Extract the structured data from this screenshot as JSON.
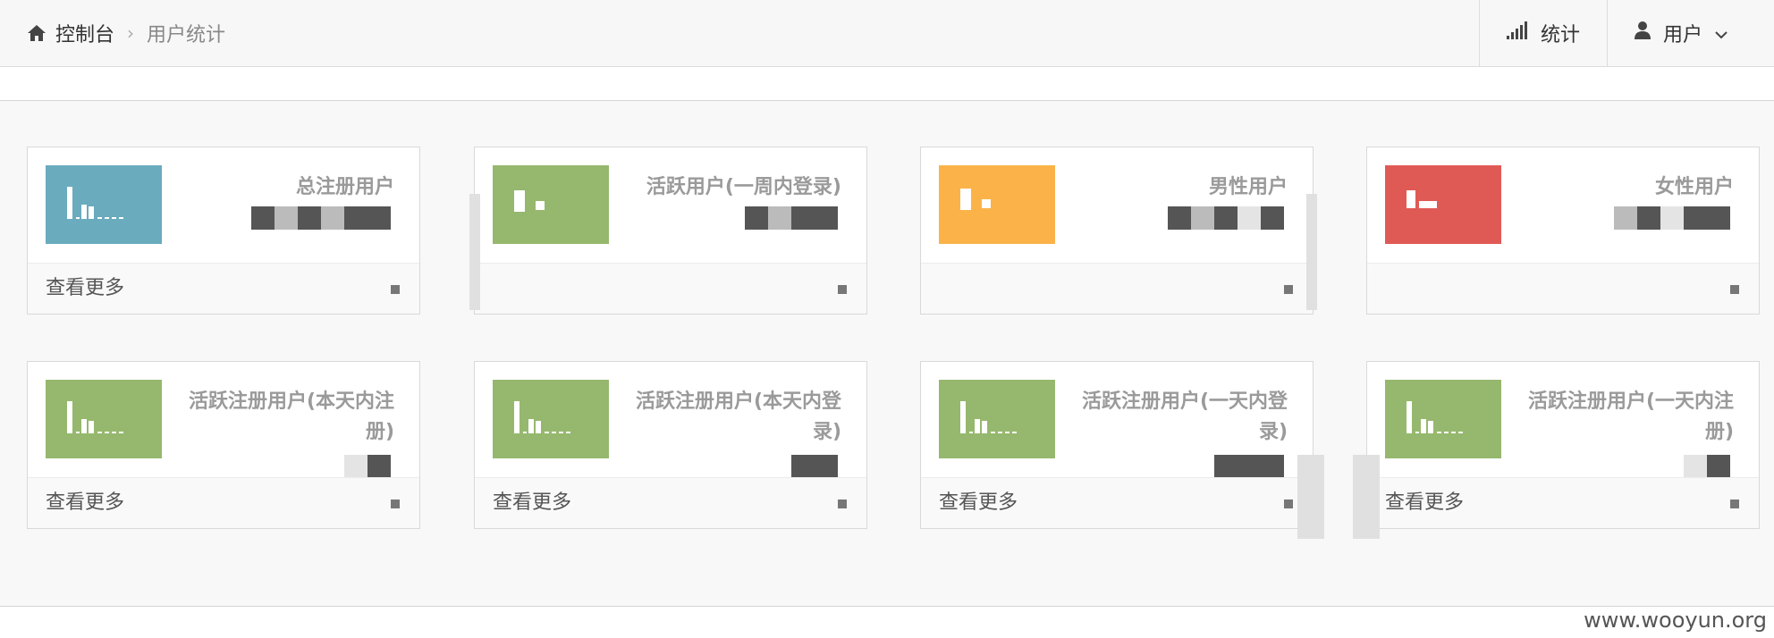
{
  "breadcrumb": {
    "home": "控制台",
    "current": "用户统计"
  },
  "nav": {
    "stats_label": "统计",
    "user_label": "用户"
  },
  "colors": {
    "blue": "#6aabbd",
    "green": "#96b86e",
    "orange": "#fbb349",
    "red": "#e05a55"
  },
  "cards": [
    {
      "title": "总注册用户",
      "footer": "查看更多"
    },
    {
      "title": "活跃用户(一周内登录)",
      "footer": ""
    },
    {
      "title": "男性用户",
      "footer": ""
    },
    {
      "title": "女性用户",
      "footer": ""
    },
    {
      "title": "活跃注册用户(本天内注册)",
      "footer": "查看更多"
    },
    {
      "title": "活跃注册用户(本天内登录)",
      "footer": "查看更多"
    },
    {
      "title": "活跃注册用户(一天内登录)",
      "footer": "查看更多"
    },
    {
      "title": "活跃注册用户(一天内注册)",
      "footer": "查看更多"
    }
  ],
  "watermark": "www.wooyun.org"
}
